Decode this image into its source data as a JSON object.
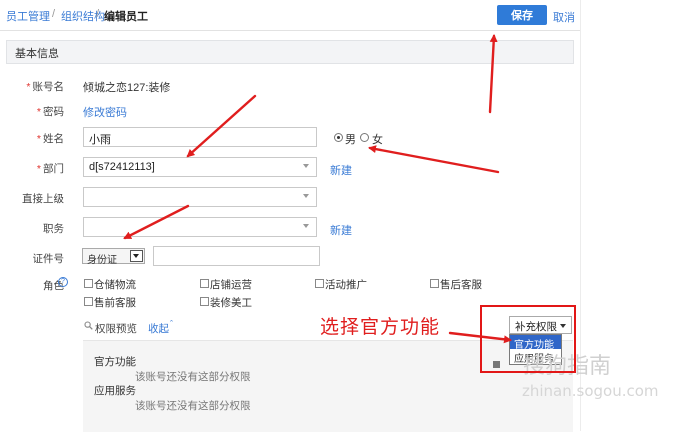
{
  "breadcrumb": {
    "item1": "员工管理",
    "sep": "/",
    "item2": "组织结构",
    "current": "编辑员工"
  },
  "toolbar": {
    "save_label": "保存",
    "cancel_label": "取消"
  },
  "section": {
    "title": "基本信息"
  },
  "form": {
    "required_mark": "*",
    "account": {
      "label": "账号名",
      "value": "倾城之恋127:装修"
    },
    "password": {
      "label": "密码",
      "link": "修改密码"
    },
    "name": {
      "label": "姓名",
      "value": "小雨"
    },
    "gender": {
      "male": "男",
      "female": "女",
      "selected": "男"
    },
    "department": {
      "label": "部门",
      "value": "d[s72412113]",
      "link": "新建"
    },
    "supervisor": {
      "label": "直接上级",
      "value": ""
    },
    "position": {
      "label": "职务",
      "value": "",
      "link": "新建"
    },
    "id_number": {
      "label": "证件号",
      "type_value": "身份证",
      "value": ""
    },
    "roles": {
      "label": "角色",
      "help_icon": "?",
      "items": [
        "仓储物流",
        "店铺运营",
        "活动推广",
        "售后客服",
        "售前客服",
        "装修美工"
      ]
    }
  },
  "permissions": {
    "preview_label": "权限预览",
    "collapse_label": "收起",
    "groups": [
      {
        "title": "官方功能",
        "empty_text": "该账号还没有这部分权限"
      },
      {
        "title": "应用服务",
        "empty_text": "该账号还没有这部分权限"
      }
    ]
  },
  "supplement": {
    "selected": "补充权限",
    "options": [
      "官方功能",
      "应用服务"
    ],
    "highlighted": "官方功能"
  },
  "annotation": {
    "callout": "选择官方功能"
  },
  "watermark": {
    "text": "搜狗指南",
    "url": "zhinan.sogou.com"
  },
  "colors": {
    "accent": "#2f7bd8",
    "annotation": "#e01e1e",
    "required": "#e0332e"
  }
}
